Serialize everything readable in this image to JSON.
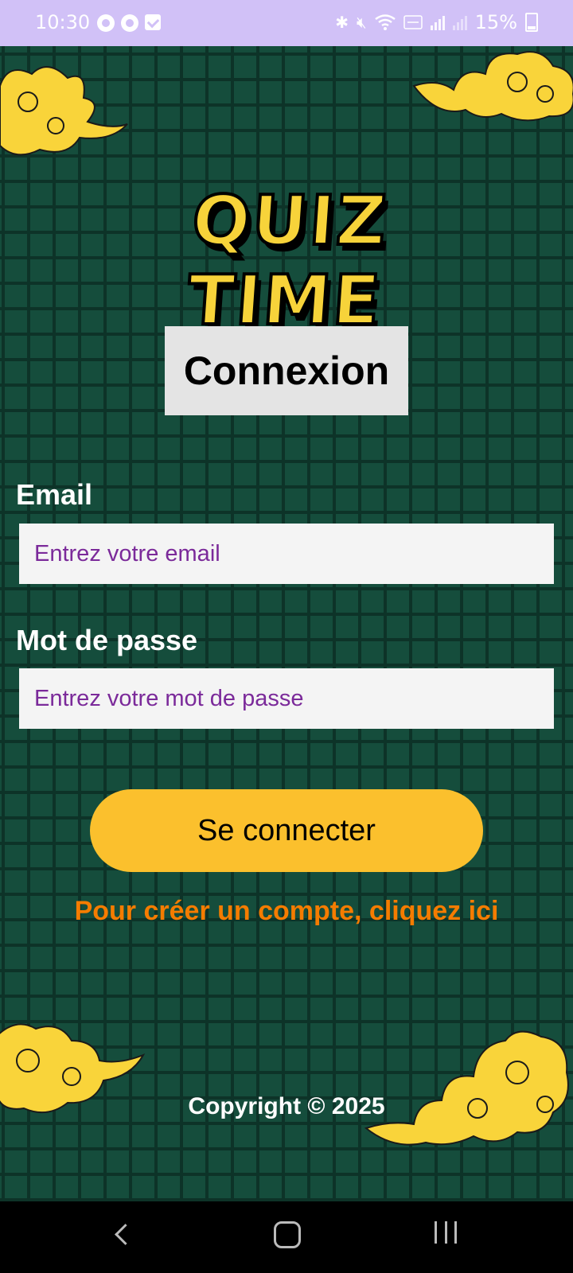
{
  "status_bar": {
    "time": "10:30",
    "battery": "15%",
    "icons": [
      "phone-call-icon",
      "phone-call-icon",
      "check-box-icon",
      "bluetooth-icon",
      "mute-icon",
      "wifi-icon",
      "volte-icon",
      "signal-icon",
      "signal-icon",
      "battery-icon"
    ]
  },
  "app": {
    "logo_text": "QUIZ TIME",
    "screen_title": "Connexion",
    "email": {
      "label": "Email",
      "placeholder": "Entrez votre email",
      "value": ""
    },
    "password": {
      "label": "Mot de passe",
      "placeholder": "Entrez votre mot de passe",
      "value": ""
    },
    "login_button": "Se connecter",
    "signup_link": "Pour créer un compte, cliquez ici",
    "copyright": "Copyright © 2025"
  },
  "colors": {
    "status_bar": "#d1c1f7",
    "background": "#154d3c",
    "grid_lines": "#0d3328",
    "logo": "#f7d33a",
    "button": "#fbc02d",
    "link": "#f57c00",
    "placeholder": "#7b2a9a",
    "cloud": "#f9d43a"
  },
  "nav_bar": {
    "icons": [
      "back-icon",
      "home-icon",
      "recent-apps-icon"
    ]
  }
}
